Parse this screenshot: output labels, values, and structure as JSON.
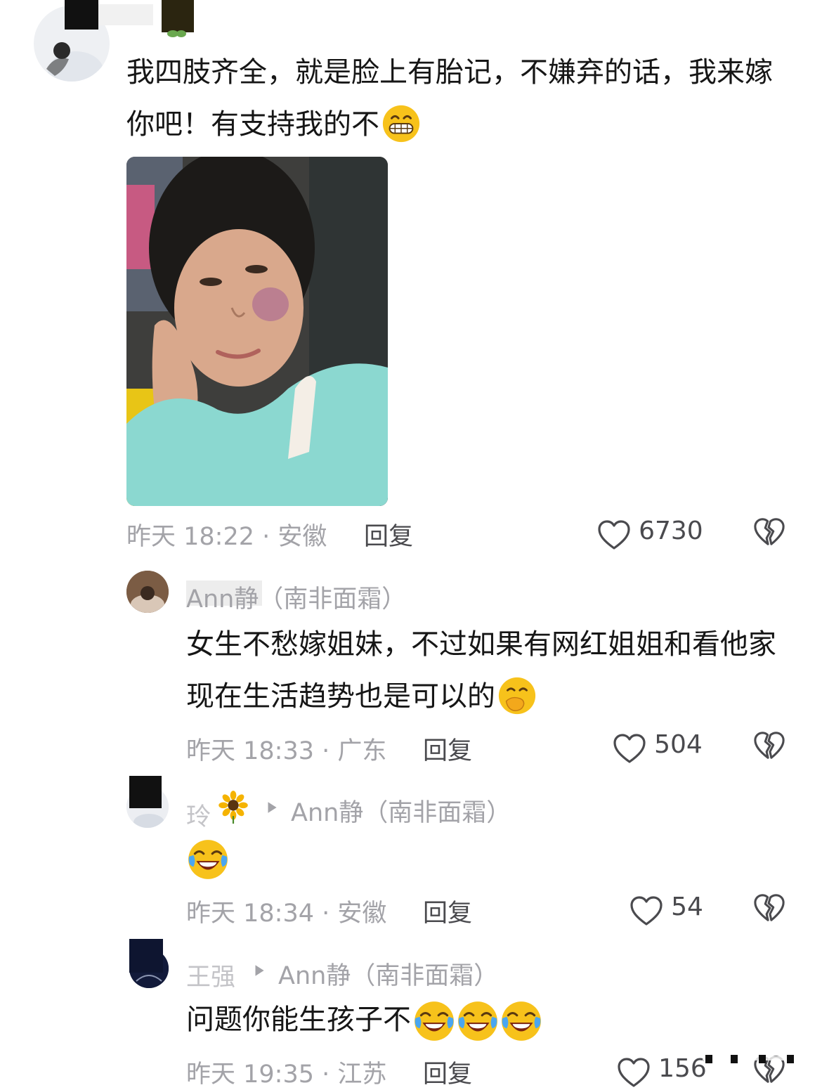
{
  "comments": [
    {
      "text": "我四肢齐全，就是脸上有胎记，不嫌弃的话，我来嫁你吧！有支持我的不",
      "emoji": "grin-emoji",
      "meta": "昨天 18:22 · 安徽",
      "reply_label": "回复",
      "likes": "6730",
      "image_alt": "woman-with-birthmark-photo"
    },
    {
      "username": "Ann静（南非面霜）",
      "text": "女生不愁嫁姐妹，不过如果有网红姐姐和看他家现在生活趋势也是可以的",
      "emoji": "hand-over-mouth-emoji",
      "meta": "昨天 18:33 · 广东",
      "reply_label": "回复",
      "likes": "504"
    },
    {
      "username": "玲",
      "reply_to": "Ann静（南非面霜）",
      "text": "",
      "emoji": "crying-laughing-emoji",
      "meta": "昨天 18:34 · 安徽",
      "reply_label": "回复",
      "likes": "54"
    },
    {
      "username": "王强",
      "reply_to": "Ann静（南非面霜）",
      "text": "问题你能生孩子不",
      "emoji": "crying-laughing-emoji",
      "meta": "昨天 19:35 · 江苏",
      "reply_label": "回复",
      "likes": "156"
    }
  ],
  "colors": {
    "meta_gray": "#a3a3a8",
    "text_dark": "#161616",
    "emoji_yellow": "#f7c21b"
  }
}
